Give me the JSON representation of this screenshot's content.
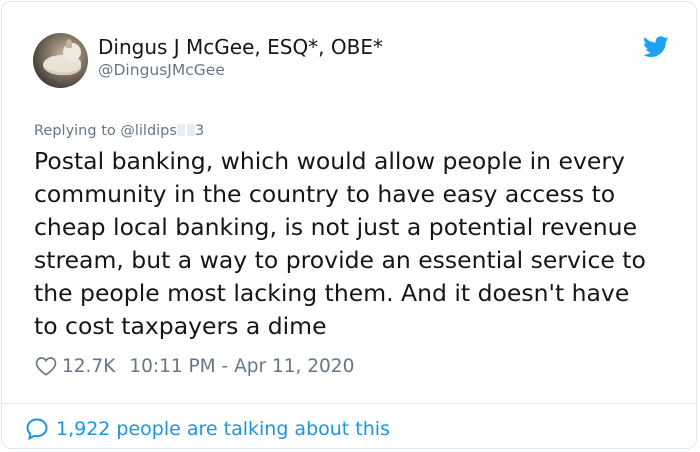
{
  "author": {
    "display_name": "Dingus J McGee, ESQ*, OBE*",
    "handle": "@DingusJMcGee",
    "avatar_icon": "dog-avatar"
  },
  "brand": {
    "icon": "twitter-bird-icon",
    "color": "#1da1f2"
  },
  "reply": {
    "prefix": "Replying to ",
    "to_handle_start": "@lildips",
    "to_handle_end": "3"
  },
  "tweet": {
    "text": "Postal banking, which would allow people in every\ncommunity in the country to have easy access to\ncheap local banking, is not just a potential revenue\nstream, but a way to provide an essential service to\nthe people most lacking them. And it doesn't have\nto cost taxpayers a dime"
  },
  "meta": {
    "likes": "12.7K",
    "timestamp": "10:11 PM - Apr 11, 2020",
    "heart_icon": "heart-outline-icon"
  },
  "footer": {
    "talking_text": "1,922 people are talking about this",
    "icon": "speech-bubble-icon",
    "color": "#1b95e0"
  },
  "colors": {
    "text_primary": "#14171a",
    "text_secondary": "#657786",
    "border": "#e1e8ed"
  }
}
